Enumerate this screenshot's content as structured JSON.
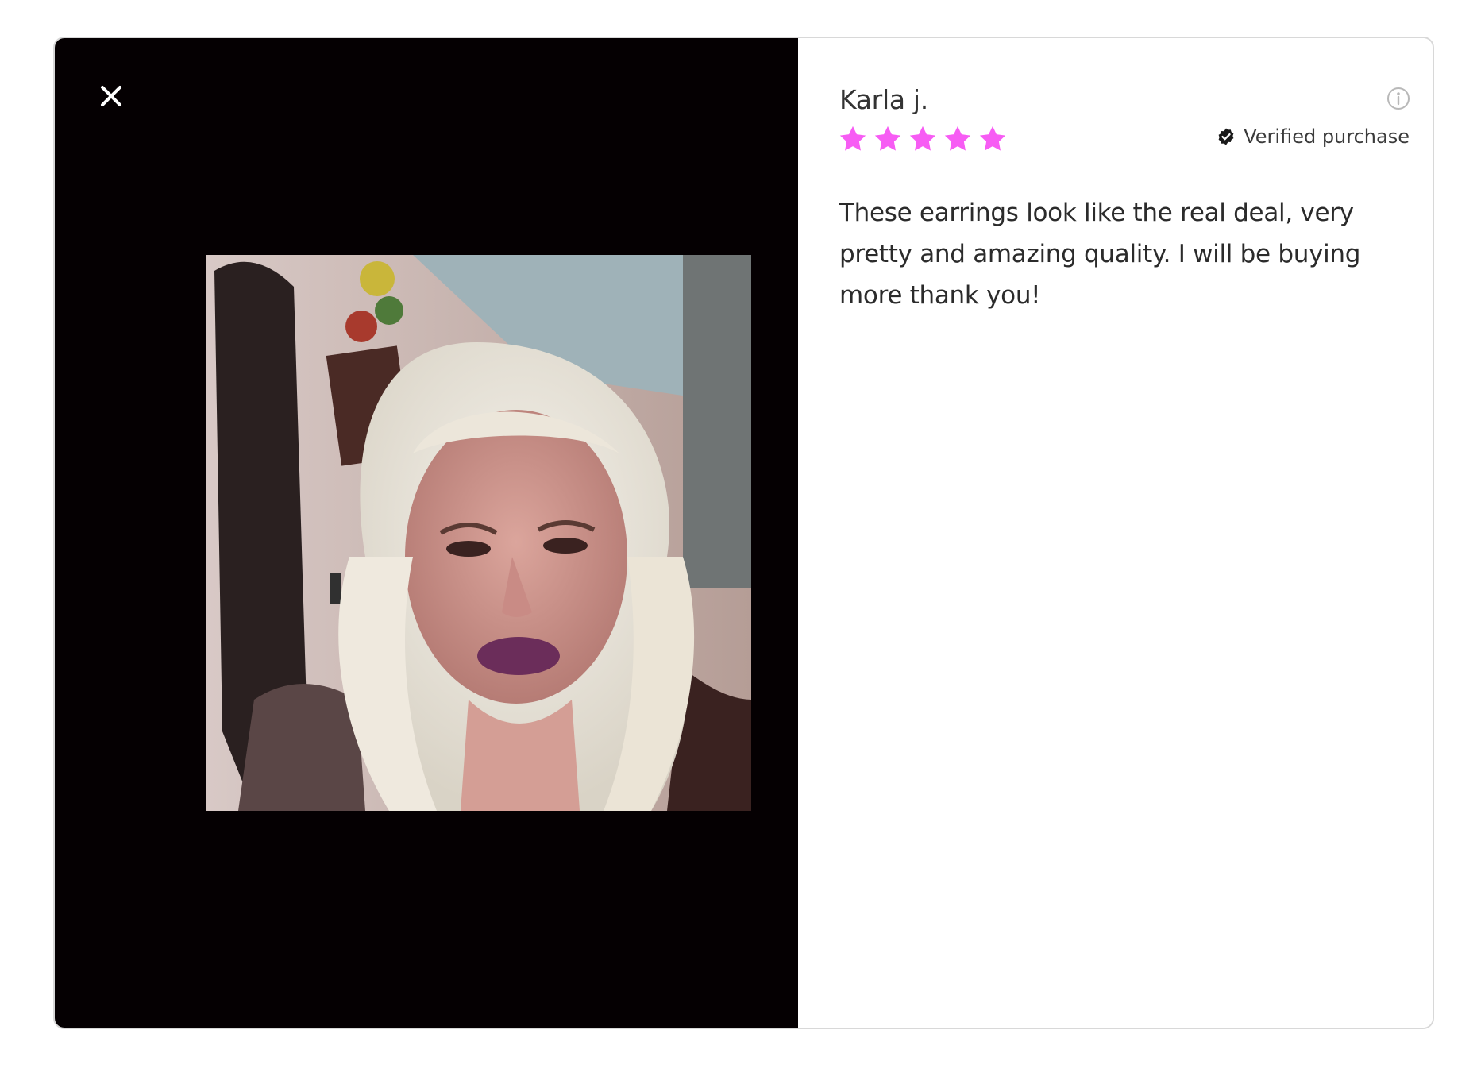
{
  "review": {
    "reviewer_name": "Karla j.",
    "rating": 5,
    "rating_max": 5,
    "verified_label": "Verified purchase",
    "body": "These earrings look like the real deal, very pretty and amazing quality. I will be buying more thank you!"
  },
  "icons": {
    "close": "close-icon",
    "info": "info-icon",
    "verified": "check-circle-icon",
    "star": "star-icon"
  },
  "colors": {
    "star": "#f75cf4",
    "media_background": "#050002"
  }
}
